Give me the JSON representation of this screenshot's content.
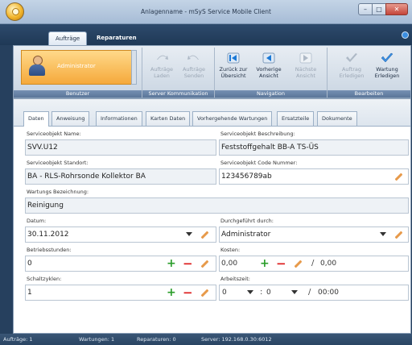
{
  "window": {
    "title": "Anlagenname - mSyS Service Mobile Client"
  },
  "ribbon_tabs": [
    {
      "label": "Aufträge"
    },
    {
      "label": "Reparaturen"
    }
  ],
  "ribbon": {
    "benutzer": {
      "user": "Administrator",
      "label": "Benutzer"
    },
    "server": {
      "label": "Server Kommunikation",
      "buttons": [
        {
          "label": "Aufträge Laden"
        },
        {
          "label": "Aufträge Senden"
        }
      ]
    },
    "navigation": {
      "label": "Navigation",
      "buttons": [
        {
          "label": "Zurück zur Übersicht"
        },
        {
          "label": "Vorherige Ansicht"
        },
        {
          "label": "Nächste Ansicht"
        }
      ]
    },
    "bearbeiten": {
      "label": "Bearbeiten",
      "buttons": [
        {
          "label": "Auftrag Erledigen"
        },
        {
          "label": "Wartung Erledigen"
        }
      ]
    }
  },
  "content_tabs": [
    "Daten",
    "Anweisung",
    "Informationen",
    "Karten Daten",
    "Vorhergehende Wartungen",
    "Ersatzteile",
    "Dokumente"
  ],
  "form": {
    "serviceobjekt_name": {
      "label": "Serviceobjekt Name:",
      "value": "SVV.U12"
    },
    "serviceobjekt_beschreibung": {
      "label": "Serviceobjekt Beschreibung:",
      "value": "Feststoffgehalt BB-A TS-ÜS"
    },
    "serviceobjekt_standort": {
      "label": "Serviceobjekt Standort:",
      "value": "BA - RLS-Rohrsonde Kollektor BA"
    },
    "serviceobjekt_code": {
      "label": "Serviceobjekt Code Nummer:",
      "value": "123456789ab"
    },
    "wartungs_bezeichnung": {
      "label": "Wartungs Bezeichnung:",
      "value": "Reinigung"
    },
    "datum": {
      "label": "Datum:",
      "value": "30.11.2012"
    },
    "durchgefuehrt": {
      "label": "Durchgeführt durch:",
      "value": "Administrator"
    },
    "betriebsstunden": {
      "label": "Betriebsstunden:",
      "value": "0"
    },
    "kosten": {
      "label": "Kosten:",
      "value": "0,00",
      "total": "0,00",
      "sep": "/"
    },
    "schaltzyklen": {
      "label": "Schaltzyklen:",
      "value": "1"
    },
    "arbeitszeit": {
      "label": "Arbeitszeit:",
      "hours": "0",
      "minutes": "0",
      "total": "00:00",
      "colon": ":",
      "sep": "/"
    }
  },
  "symbols": {
    "plus": "+",
    "minus": "−",
    "window_min": "–",
    "window_max": "□",
    "window_close": "✕"
  },
  "status": {
    "auftraege": "Aufträge: 1",
    "wartungen": "Wartungen: 1",
    "reparaturen": "Reparaturen: 0",
    "server": "Server: 192.168.0.30:6012"
  }
}
